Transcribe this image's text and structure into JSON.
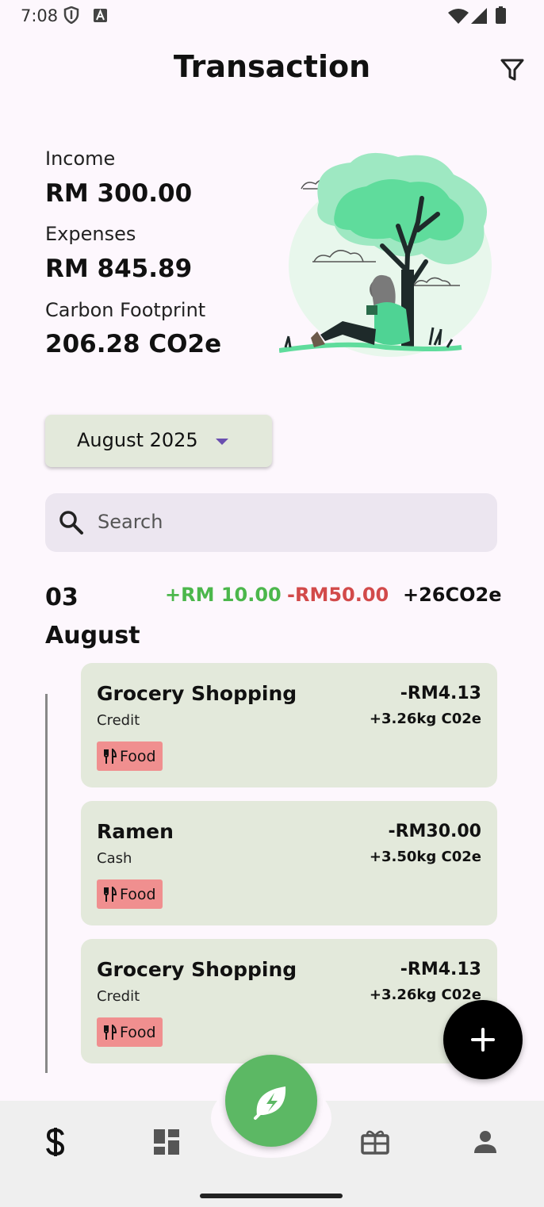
{
  "status_bar": {
    "time": "7:08"
  },
  "header": {
    "title": "Transaction",
    "filter_icon": "filter-icon"
  },
  "summary": {
    "income_label": "Income",
    "income_value": "RM 300.00",
    "expenses_label": "Expenses",
    "expenses_value": "RM 845.89",
    "carbon_label": "Carbon Footprint",
    "carbon_value": "206.28 CO2e",
    "illustration": "tree-reading-illustration"
  },
  "month_selector": {
    "label": "August 2025"
  },
  "search": {
    "placeholder": "Search",
    "value": ""
  },
  "day_group": {
    "day": "03",
    "month": "August",
    "income": "+RM 10.00",
    "expense": "-RM50.00",
    "co2": "+26CO2e"
  },
  "transactions": [
    {
      "name": "Grocery Shopping",
      "method": "Credit",
      "amount": "-RM4.13",
      "co2": "+3.26kg C02e",
      "tag": "Food"
    },
    {
      "name": "Ramen",
      "method": "Cash",
      "amount": "-RM30.00",
      "co2": "+3.50kg C02e",
      "tag": "Food"
    },
    {
      "name": "Grocery Shopping",
      "method": "Credit",
      "amount": "-RM4.13",
      "co2": "+3.26kg C02e",
      "tag": "Food"
    }
  ],
  "bottom_nav": {
    "items": [
      "dollar-icon",
      "dashboard-icon",
      "eco-lightning-icon",
      "gift-icon",
      "person-icon"
    ]
  },
  "colors": {
    "income": "#4cb74c",
    "expense": "#d24a4a",
    "card": "#e3e9db",
    "tag": "#f08f8f",
    "fab_center": "#5cb864"
  }
}
